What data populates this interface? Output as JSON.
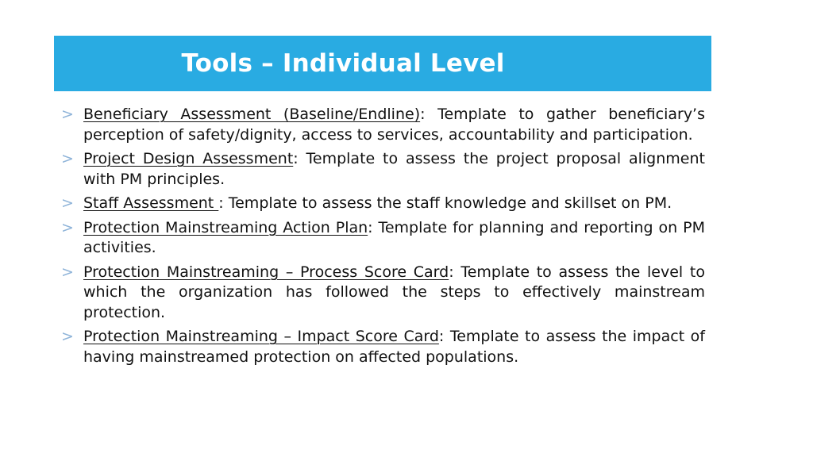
{
  "title": "Tools – Individual Level",
  "bullet_glyph": ">",
  "items": [
    {
      "term": "Beneficiary Assessment (Baseline/Endline)",
      "description": ": Template to gather beneficiary’s perception of safety/dignity, access to services, accountability and participation."
    },
    {
      "term": "Project Design Assessment",
      "description": ": Template to assess the project proposal alignment with PM principles."
    },
    {
      "term": "Staff Assessment ",
      "description": ": Template to assess the staff knowledge and skillset on PM."
    },
    {
      "term": "Protection Mainstreaming Action Plan",
      "description": ": Template for planning and reporting on PM activities."
    },
    {
      "term": "Protection Mainstreaming – Process Score Card",
      "description": ": Template to assess the level to which the organization has followed the steps to effectively mainstream protection."
    },
    {
      "term": "Protection Mainstreaming – Impact Score Card",
      "description": ": Template to assess the impact of having mainstreamed protection on affected populations."
    }
  ]
}
